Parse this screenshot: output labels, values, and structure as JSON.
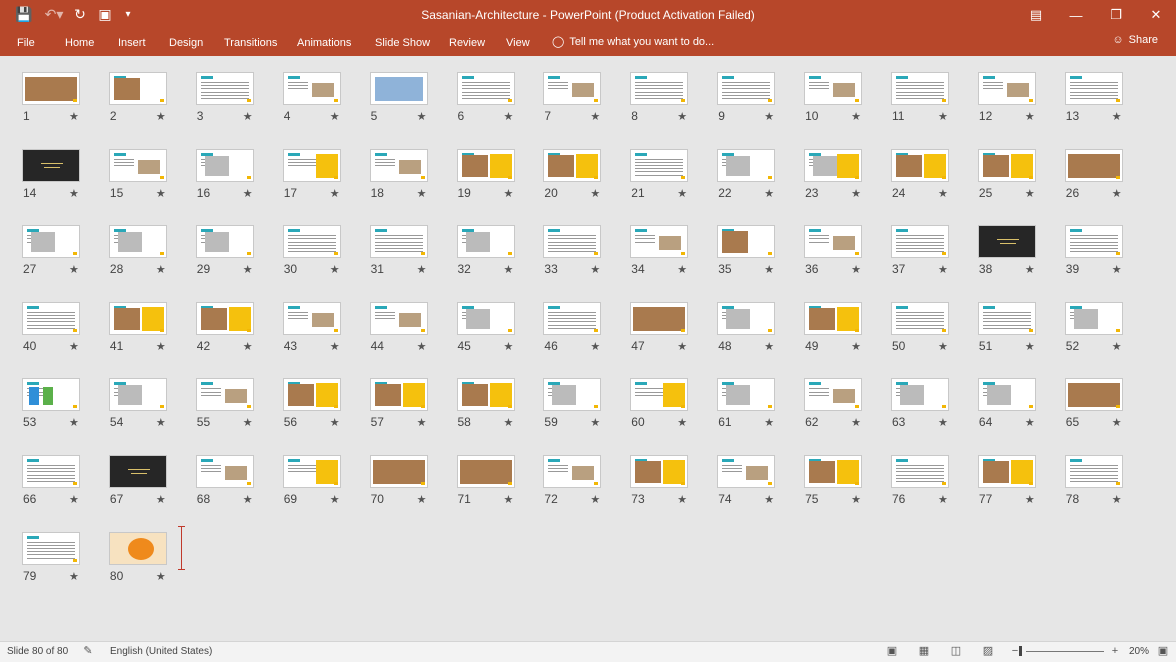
{
  "window": {
    "title": "Sasanian-Architecture - PowerPoint (Product Activation Failed)",
    "controls": [
      "restore-ribbon",
      "minimize",
      "maximize",
      "close"
    ]
  },
  "ribbon": {
    "file": "File",
    "tabs": [
      "Home",
      "Insert",
      "Design",
      "Transitions",
      "Animations",
      "Slide Show",
      "Review",
      "View"
    ],
    "tell_me": "Tell me what you want to do...",
    "share": "Share"
  },
  "slides": [
    {
      "n": "1",
      "k": "photo"
    },
    {
      "n": "2",
      "k": "photo-text"
    },
    {
      "n": "3",
      "k": "text"
    },
    {
      "n": "4",
      "k": "text-img"
    },
    {
      "n": "5",
      "k": "map"
    },
    {
      "n": "6",
      "k": "text"
    },
    {
      "n": "7",
      "k": "text-img"
    },
    {
      "n": "8",
      "k": "text"
    },
    {
      "n": "9",
      "k": "text"
    },
    {
      "n": "10",
      "k": "text-img"
    },
    {
      "n": "11",
      "k": "text"
    },
    {
      "n": "12",
      "k": "text-img"
    },
    {
      "n": "13",
      "k": "text"
    },
    {
      "n": "14",
      "k": "dark"
    },
    {
      "n": "15",
      "k": "text-img"
    },
    {
      "n": "16",
      "k": "drawing"
    },
    {
      "n": "17",
      "k": "text-yellow"
    },
    {
      "n": "18",
      "k": "text-img"
    },
    {
      "n": "19",
      "k": "photo-yellow"
    },
    {
      "n": "20",
      "k": "photo-yellow"
    },
    {
      "n": "21",
      "k": "text"
    },
    {
      "n": "22",
      "k": "drawing"
    },
    {
      "n": "23",
      "k": "drawing-yellow"
    },
    {
      "n": "24",
      "k": "photo-yellow"
    },
    {
      "n": "25",
      "k": "photo-yellow"
    },
    {
      "n": "26",
      "k": "photo"
    },
    {
      "n": "27",
      "k": "drawing"
    },
    {
      "n": "28",
      "k": "drawing"
    },
    {
      "n": "29",
      "k": "drawing"
    },
    {
      "n": "30",
      "k": "text"
    },
    {
      "n": "31",
      "k": "text"
    },
    {
      "n": "32",
      "k": "drawing"
    },
    {
      "n": "33",
      "k": "text"
    },
    {
      "n": "34",
      "k": "text-img"
    },
    {
      "n": "35",
      "k": "photo-text"
    },
    {
      "n": "36",
      "k": "text-img"
    },
    {
      "n": "37",
      "k": "text"
    },
    {
      "n": "38",
      "k": "dark"
    },
    {
      "n": "39",
      "k": "text"
    },
    {
      "n": "40",
      "k": "text"
    },
    {
      "n": "41",
      "k": "photo-yellow"
    },
    {
      "n": "42",
      "k": "photo-yellow"
    },
    {
      "n": "43",
      "k": "text-img"
    },
    {
      "n": "44",
      "k": "text-img"
    },
    {
      "n": "45",
      "k": "drawing"
    },
    {
      "n": "46",
      "k": "text"
    },
    {
      "n": "47",
      "k": "photo"
    },
    {
      "n": "48",
      "k": "drawing"
    },
    {
      "n": "49",
      "k": "photo-yellow"
    },
    {
      "n": "50",
      "k": "text"
    },
    {
      "n": "51",
      "k": "text"
    },
    {
      "n": "52",
      "k": "drawing"
    },
    {
      "n": "53",
      "k": "diagram"
    },
    {
      "n": "54",
      "k": "drawing"
    },
    {
      "n": "55",
      "k": "text-img"
    },
    {
      "n": "56",
      "k": "photo-yellow"
    },
    {
      "n": "57",
      "k": "photo-yellow"
    },
    {
      "n": "58",
      "k": "photo-yellow"
    },
    {
      "n": "59",
      "k": "drawing"
    },
    {
      "n": "60",
      "k": "text-yellow"
    },
    {
      "n": "61",
      "k": "drawing"
    },
    {
      "n": "62",
      "k": "text-img"
    },
    {
      "n": "63",
      "k": "drawing"
    },
    {
      "n": "64",
      "k": "drawing"
    },
    {
      "n": "65",
      "k": "photo"
    },
    {
      "n": "66",
      "k": "text"
    },
    {
      "n": "67",
      "k": "dark"
    },
    {
      "n": "68",
      "k": "text-img"
    },
    {
      "n": "69",
      "k": "text-yellow"
    },
    {
      "n": "70",
      "k": "photo"
    },
    {
      "n": "71",
      "k": "photo"
    },
    {
      "n": "72",
      "k": "text-img"
    },
    {
      "n": "73",
      "k": "photo-yellow"
    },
    {
      "n": "74",
      "k": "text-img"
    },
    {
      "n": "75",
      "k": "photo-yellow"
    },
    {
      "n": "76",
      "k": "text"
    },
    {
      "n": "77",
      "k": "photo-yellow"
    },
    {
      "n": "78",
      "k": "text"
    },
    {
      "n": "79",
      "k": "text"
    },
    {
      "n": "80",
      "k": "warm"
    }
  ],
  "status": {
    "slide_counter": "Slide 80 of 80",
    "language": "English (United States)",
    "zoom": "20%"
  }
}
